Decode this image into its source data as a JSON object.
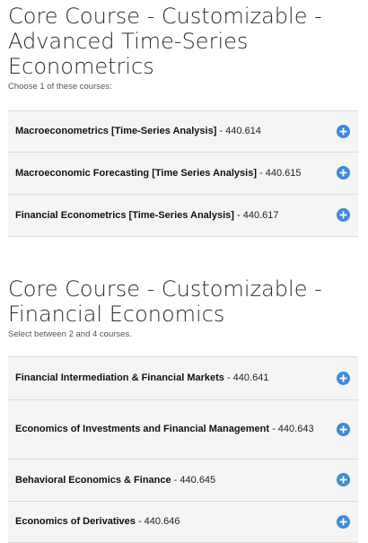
{
  "sections": [
    {
      "title_line1": "Core Course - Customizable -",
      "title_line2": "Advanced Time-Series",
      "title_line3": "Econometrics",
      "subtitle": "Choose 1 of these courses:",
      "courses": [
        {
          "name": "Macroeconometrics [Time-Series Analysis]",
          "separator": " - ",
          "number": "440.614"
        },
        {
          "name": "Macroeconomic Forecasting [Time Series Analysis]",
          "separator": " - ",
          "number": "440.615"
        },
        {
          "name": "Financial Econometrics [Time-Series Analysis]",
          "separator": " - ",
          "number": "440.617"
        }
      ]
    },
    {
      "title_line1": "Core Course - Customizable -",
      "title_line2": "Financial Economics",
      "subtitle": "Select between 2 and 4 courses.",
      "courses": [
        {
          "name": "Financial Intermediation & Financial Markets",
          "separator": " - ",
          "number": "440.641"
        },
        {
          "name": "Economics of Investments and Financial Management",
          "separator": " - ",
          "number": "440.643"
        },
        {
          "name": "Behavioral Economics & Finance",
          "separator": " - ",
          "number": "440.645"
        },
        {
          "name": "Economics of Derivatives",
          "separator": " - ",
          "number": "440.646"
        }
      ]
    }
  ],
  "icons": {
    "expand": "plus-circle-icon"
  },
  "colors": {
    "accent": "#3e8ad6",
    "row_background": "#f5f5f5",
    "divider": "#dcdcdc",
    "title_text": "#2b2b2b"
  }
}
